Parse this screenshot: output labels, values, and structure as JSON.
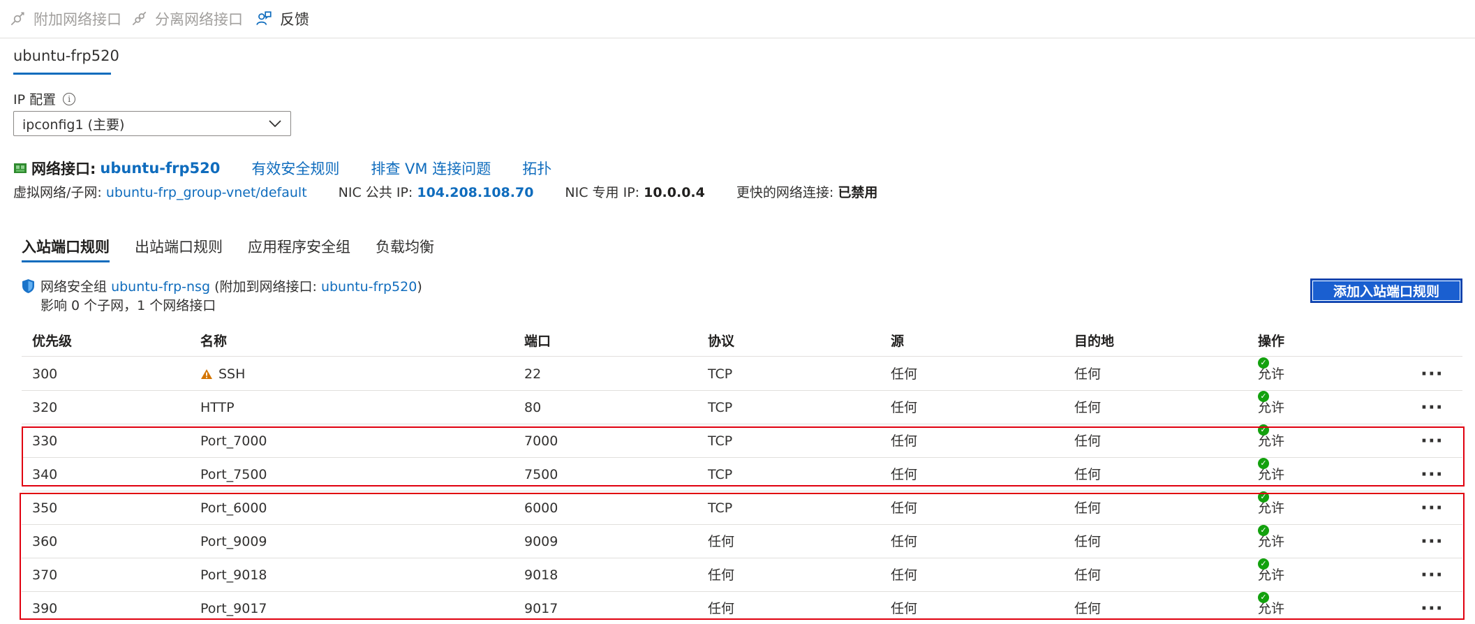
{
  "toolbar": {
    "attach_label": "附加网络接口",
    "detach_label": "分离网络接口",
    "feedback_label": "反馈"
  },
  "nic_tab": "ubuntu-frp520",
  "ip_config": {
    "label": "IP 配置",
    "selected": "ipconfig1 (主要)"
  },
  "nic": {
    "label": "网络接口:",
    "name": "ubuntu-frp520",
    "links": [
      "有效安全规则",
      "排查 VM 连接问题",
      "拓扑"
    ]
  },
  "info": {
    "vnet_label": "虚拟网络/子网:",
    "vnet_value": "ubuntu-frp_group-vnet/default",
    "public_ip_label": "NIC 公共 IP:",
    "public_ip_value": "104.208.108.70",
    "private_ip_label": "NIC 专用 IP:",
    "private_ip_value": "10.0.0.4",
    "accel_label": "更快的网络连接:",
    "accel_value": "已禁用"
  },
  "rule_tabs": [
    "入站端口规则",
    "出站端口规则",
    "应用程序安全组",
    "负载均衡"
  ],
  "nsg": {
    "prefix": "网络安全组",
    "name": "ubuntu-frp-nsg",
    "attach_prefix": "(附加到网络接口:",
    "attach_nic": "ubuntu-frp520",
    "attach_suffix": ")",
    "impact": "影响 0 个子网，1 个网络接口"
  },
  "add_button": "添加入站端口规则",
  "table": {
    "headers": [
      "优先级",
      "名称",
      "端口",
      "协议",
      "源",
      "目的地",
      "操作"
    ],
    "rows": [
      {
        "priority": "300",
        "name": "SSH",
        "port": "22",
        "protocol": "TCP",
        "source": "任何",
        "destination": "任何",
        "action": "允许",
        "warning": true
      },
      {
        "priority": "320",
        "name": "HTTP",
        "port": "80",
        "protocol": "TCP",
        "source": "任何",
        "destination": "任何",
        "action": "允许"
      },
      {
        "priority": "330",
        "name": "Port_7000",
        "port": "7000",
        "protocol": "TCP",
        "source": "任何",
        "destination": "任何",
        "action": "允许"
      },
      {
        "priority": "340",
        "name": "Port_7500",
        "port": "7500",
        "protocol": "TCP",
        "source": "任何",
        "destination": "任何",
        "action": "允许"
      },
      {
        "priority": "350",
        "name": "Port_6000",
        "port": "6000",
        "protocol": "TCP",
        "source": "任何",
        "destination": "任何",
        "action": "允许"
      },
      {
        "priority": "360",
        "name": "Port_9009",
        "port": "9009",
        "protocol": "任何",
        "source": "任何",
        "destination": "任何",
        "action": "允许"
      },
      {
        "priority": "370",
        "name": "Port_9018",
        "port": "9018",
        "protocol": "任何",
        "source": "任何",
        "destination": "任何",
        "action": "允许"
      },
      {
        "priority": "390",
        "name": "Port_9017",
        "port": "9017",
        "protocol": "任何",
        "source": "任何",
        "destination": "任何",
        "action": "允许"
      }
    ]
  },
  "colors": {
    "accent": "#0f6cbd",
    "button": "#1a5fd0",
    "allow": "#13a10e",
    "warning": "#d47500",
    "highlight": "#e0000f"
  },
  "icons": [
    "attach-icon",
    "detach-icon",
    "feedback-icon",
    "info-icon",
    "chevron-down-icon",
    "nic-icon",
    "shield-icon",
    "warning-icon",
    "check-icon",
    "more-icon"
  ]
}
